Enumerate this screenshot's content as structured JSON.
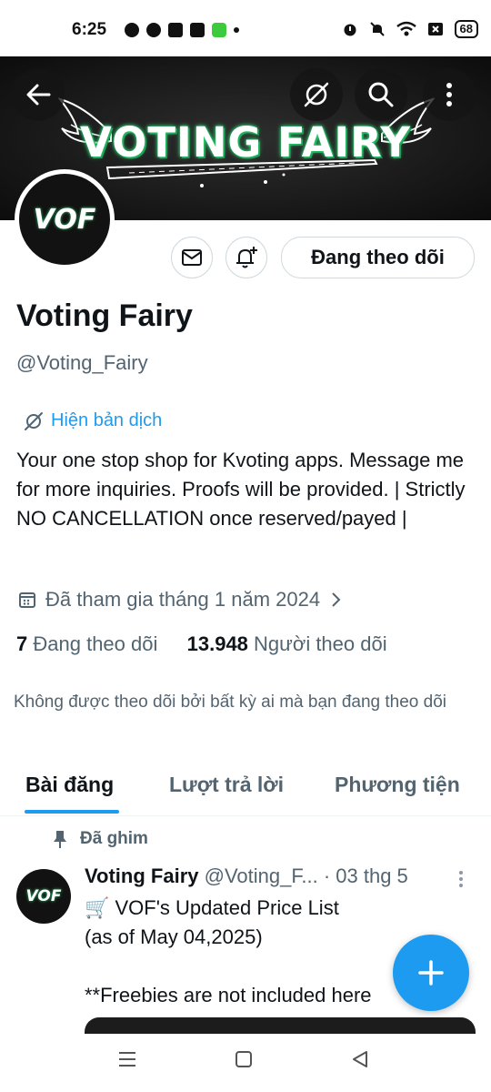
{
  "status_bar": {
    "time": "6:25",
    "battery": "68"
  },
  "banner": {
    "title": "VOTING FAIRY"
  },
  "profile": {
    "avatar_text": "VOF",
    "follow_label": "Đang theo dõi",
    "name": "Voting Fairy",
    "handle": "@Voting_Fairy",
    "translate_label": "Hiện bản dịch",
    "bio": "Your one stop shop for Kvoting apps. Message me for more inquiries. Proofs will be provided. | Strictly NO CANCELLATION once reserved/payed |",
    "joined": "Đã tham gia tháng 1 năm 2024",
    "following_count": "7",
    "following_label": "Đang theo dõi",
    "followers_count": "13.948",
    "followers_label": "Người theo dõi",
    "not_followed_text": "Không được theo dõi bởi bất kỳ ai mà bạn đang theo dõi"
  },
  "tabs": [
    {
      "label": "Bài đăng"
    },
    {
      "label": "Lượt trả lời"
    },
    {
      "label": "Phương tiện"
    }
  ],
  "pinned_post": {
    "pinned_label": "Đã ghim",
    "author_name": "Voting Fairy",
    "author_handle": "@Voting_F...",
    "date": "· 03 thg 5",
    "avatar_text": "VOF",
    "text": "🛒 VOF's Updated Price List\n(as of May 04,2025)\n\n**Freebies are not included here"
  },
  "colors": {
    "accent": "#1d9bf0",
    "text": "#0f1419",
    "secondary_text": "#536471",
    "banner_glow": "#2ecc71"
  }
}
